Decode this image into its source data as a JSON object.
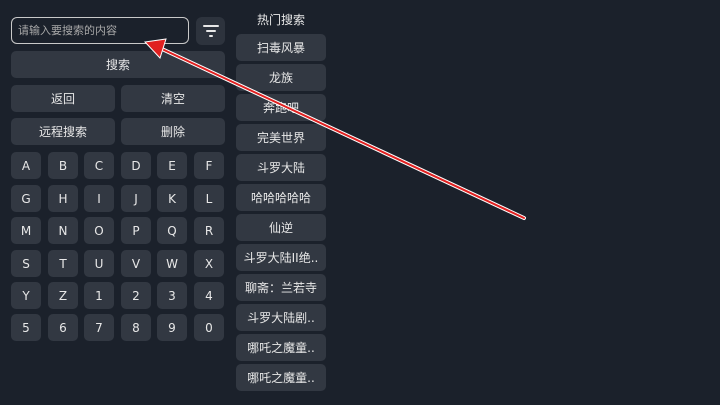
{
  "search": {
    "placeholder": "请输入要搜索的内容"
  },
  "icons": {
    "filter": "filter-icon"
  },
  "buttons": {
    "search": "搜索",
    "back": "返回",
    "clear": "清空",
    "remote_search": "远程搜索",
    "delete": "删除"
  },
  "keyboard": {
    "rows": [
      [
        "A",
        "B",
        "C",
        "D",
        "E",
        "F"
      ],
      [
        "G",
        "H",
        "I",
        "J",
        "K",
        "L"
      ],
      [
        "M",
        "N",
        "O",
        "P",
        "Q",
        "R"
      ],
      [
        "S",
        "T",
        "U",
        "V",
        "W",
        "X"
      ],
      [
        "Y",
        "Z",
        "1",
        "2",
        "3",
        "4"
      ],
      [
        "5",
        "6",
        "7",
        "8",
        "9",
        "0"
      ]
    ]
  },
  "hot": {
    "title": "热门搜索",
    "items": [
      "扫毒风暴",
      "龙族",
      "奔跑吧",
      "完美世界",
      "斗罗大陆",
      "哈哈哈哈哈",
      "仙逆",
      "斗罗大陆II绝..",
      "聊斋：兰若寺",
      "斗罗大陆剧..",
      "哪吒之魔童..",
      "哪吒之魔童.."
    ]
  },
  "annotation": {
    "arrow_color": "#e02020"
  }
}
